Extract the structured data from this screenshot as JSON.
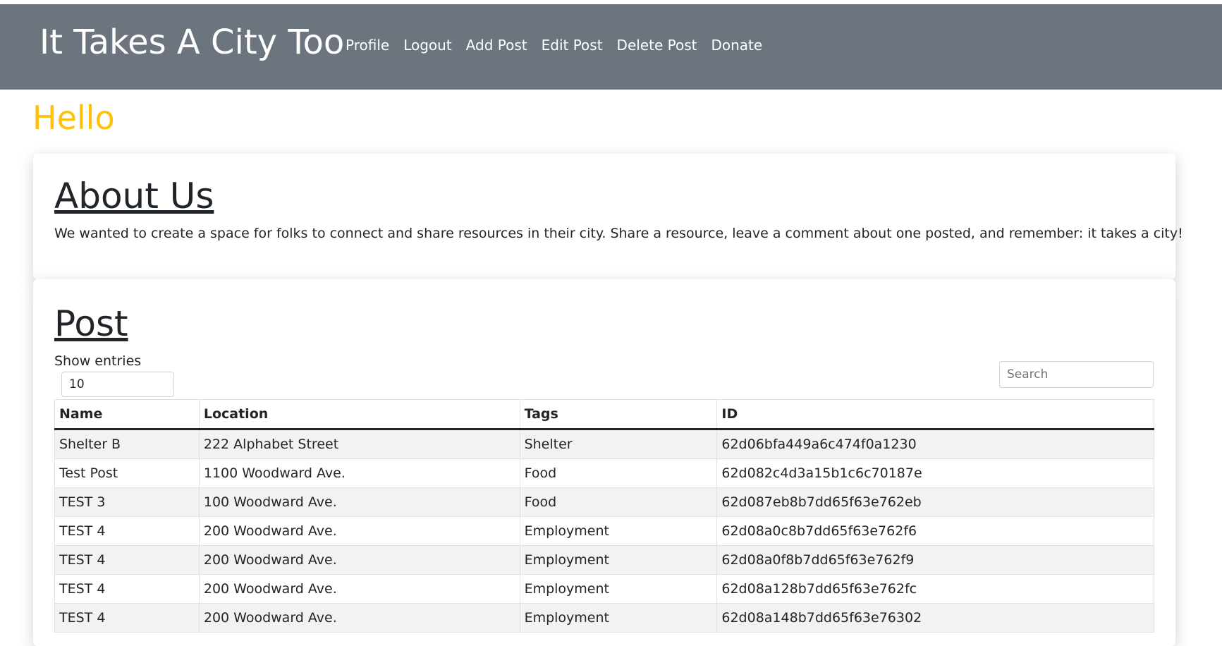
{
  "header": {
    "brand": "It Takes A City Too",
    "nav": [
      "Profile",
      "Logout",
      "Add Post",
      "Edit Post",
      "Delete Post",
      "Donate"
    ]
  },
  "greeting": "Hello",
  "about": {
    "title": "About Us",
    "text": "We wanted to create a space for folks to connect and share resources in their city. Share a resource, leave a comment about one posted, and remember: it takes a city!"
  },
  "post": {
    "title": "Post",
    "show_entries_label": "Show entries",
    "entries_value": "10",
    "search_placeholder": "Search",
    "columns": [
      "Name",
      "Location",
      "Tags",
      "ID"
    ],
    "rows": [
      [
        "Shelter B",
        "222 Alphabet Street",
        "Shelter",
        "62d06bfa449a6c474f0a1230"
      ],
      [
        "Test Post",
        "1100 Woodward Ave.",
        "Food",
        "62d082c4d3a15b1c6c70187e"
      ],
      [
        "TEST 3",
        "100 Woodward Ave.",
        "Food",
        "62d087eb8b7dd65f63e762eb"
      ],
      [
        "TEST 4",
        "200 Woodward Ave.",
        "Employment",
        "62d08a0c8b7dd65f63e762f6"
      ],
      [
        "TEST 4",
        "200 Woodward Ave.",
        "Employment",
        "62d08a0f8b7dd65f63e762f9"
      ],
      [
        "TEST 4",
        "200 Woodward Ave.",
        "Employment",
        "62d08a128b7dd65f63e762fc"
      ],
      [
        "TEST 4",
        "200 Woodward Ave.",
        "Employment",
        "62d08a148b7dd65f63e76302"
      ]
    ]
  },
  "colors": {
    "navbar": "#6c757d",
    "greeting": "#ffc107",
    "stripe": "#f2f2f2"
  }
}
